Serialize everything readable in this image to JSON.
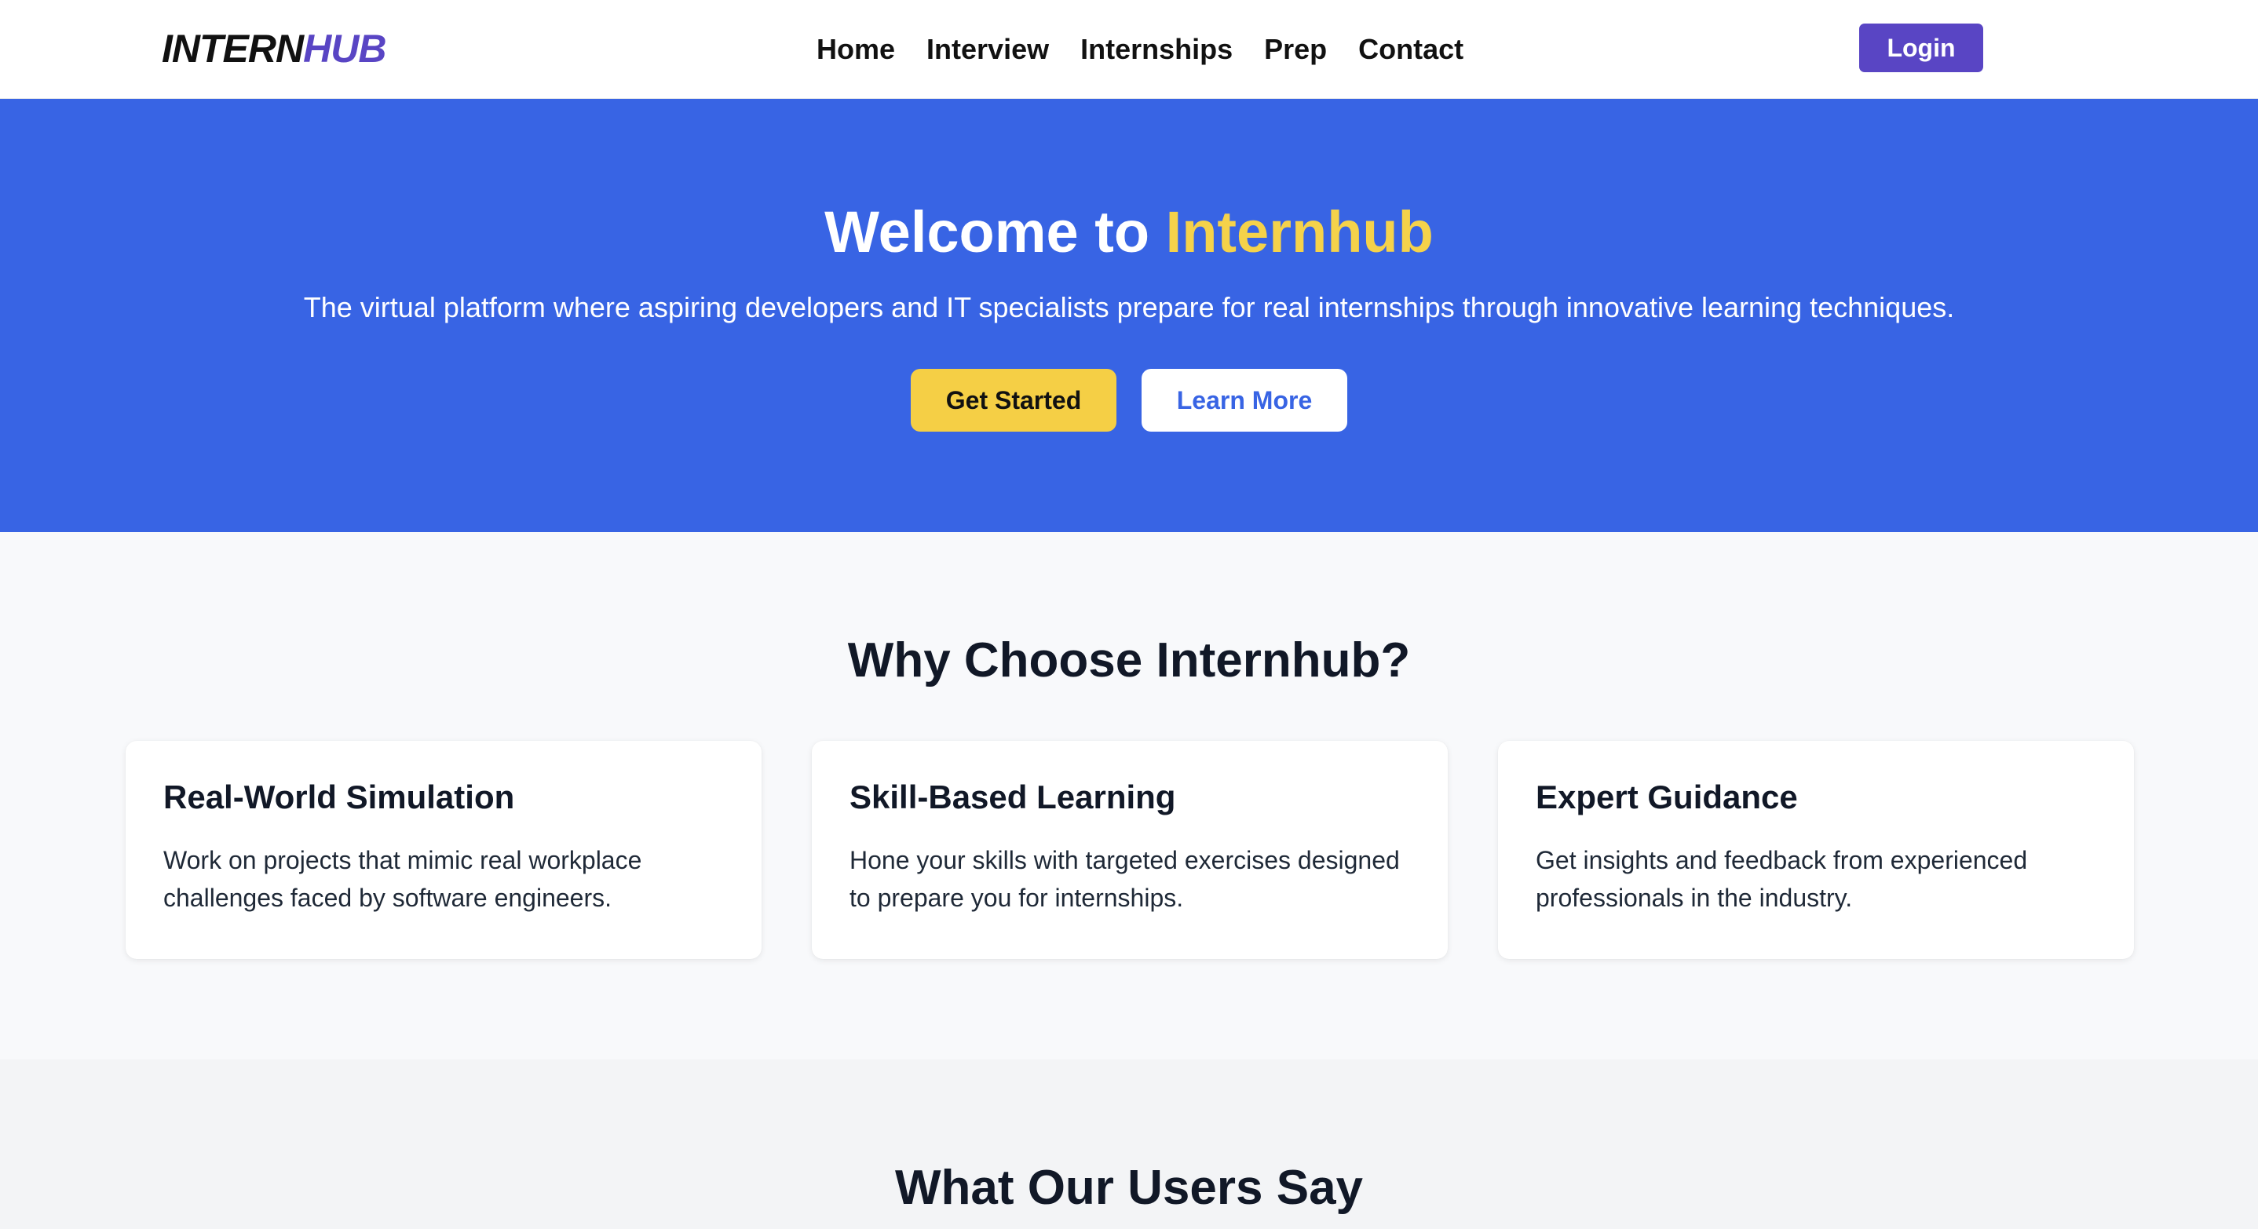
{
  "nav": {
    "logo_part1": "INTERN",
    "logo_part2": "HUB",
    "links": [
      "Home",
      "Interview",
      "Internships",
      "Prep",
      "Contact"
    ],
    "login_label": "Login"
  },
  "hero": {
    "title_prefix": "Welcome to ",
    "title_accent": "Internhub",
    "subtitle": "The virtual platform where aspiring developers and IT specialists prepare for real internships through innovative learning techniques.",
    "primary_button": "Get Started",
    "secondary_button": "Learn More"
  },
  "features": {
    "title": "Why Choose Internhub?",
    "cards": [
      {
        "title": "Real-World Simulation",
        "text": "Work on projects that mimic real workplace challenges faced by software engineers."
      },
      {
        "title": "Skill-Based Learning",
        "text": "Hone your skills with targeted exercises designed to prepare you for internships."
      },
      {
        "title": "Expert Guidance",
        "text": "Get insights and feedback from experienced professionals in the industry."
      }
    ]
  },
  "testimonials": {
    "title": "What Our Users Say"
  },
  "colors": {
    "brand_purple": "#5945c4",
    "hero_blue": "#3864e4",
    "accent_yellow": "#f5d24a"
  }
}
